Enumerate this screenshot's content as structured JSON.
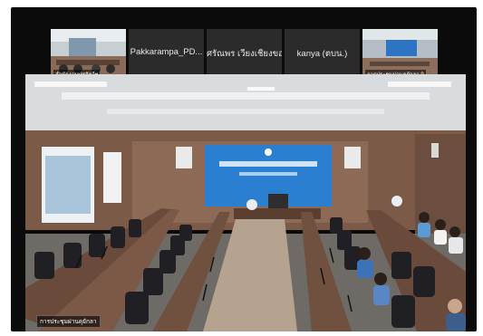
{
  "participants": [
    {
      "name": "",
      "caption": "สำนักงานปศุสัตว์ฯ",
      "type": "video"
    },
    {
      "name": "Pakkarampa_PD...",
      "caption": "",
      "type": "avatar"
    },
    {
      "name": "ศรัณพร เวียงเชียงของ",
      "caption": "",
      "type": "avatar"
    },
    {
      "name": "kanya (ตบน.)",
      "caption": "",
      "type": "avatar"
    },
    {
      "name": "",
      "caption": "การประชุมผ่านคุยักลา 9",
      "type": "video"
    }
  ],
  "main_video": {
    "caption": "การประชุมผ่านคุยักลา"
  },
  "colors": {
    "background": "#0b0b0b",
    "tile": "#2b2b2b",
    "stage_backdrop": "#2a7fd0"
  }
}
